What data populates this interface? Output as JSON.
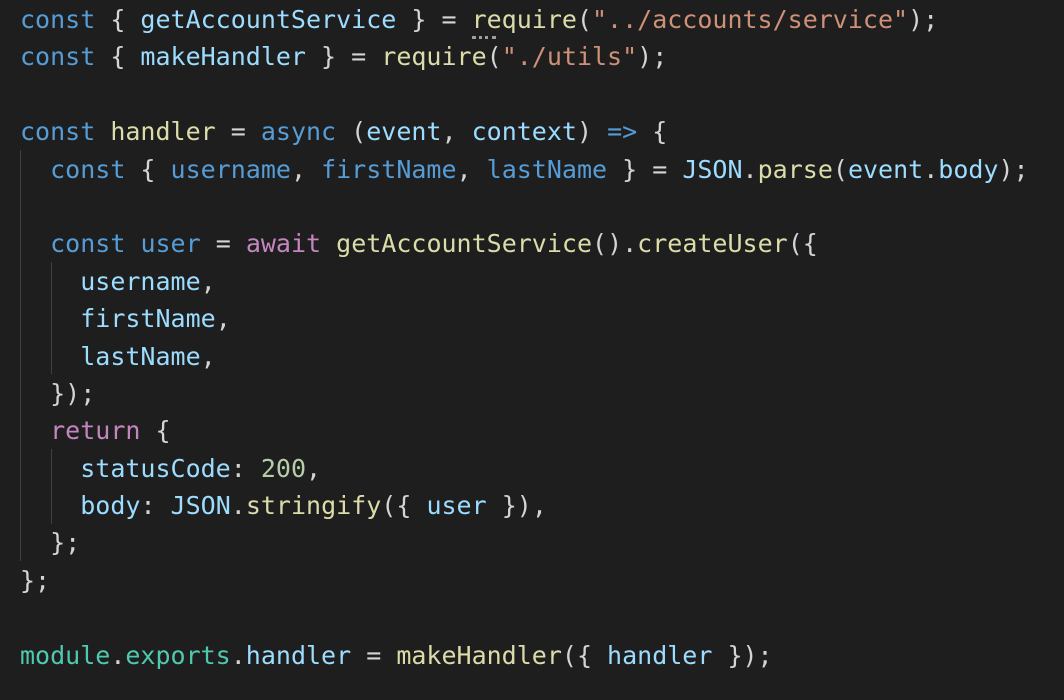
{
  "editor": {
    "background": "#1e1e1e",
    "lines": [
      [
        {
          "t": "const",
          "c": "kw"
        },
        {
          "t": " { ",
          "c": "pun"
        },
        {
          "t": "getAccountService",
          "c": "var"
        },
        {
          "t": " } = ",
          "c": "pun"
        },
        {
          "t": "require",
          "c": "fn"
        },
        {
          "t": "(",
          "c": "pun"
        },
        {
          "t": "\"../accounts/service\"",
          "c": "str"
        },
        {
          "t": ");",
          "c": "pun"
        }
      ],
      [
        {
          "t": "const",
          "c": "kw"
        },
        {
          "t": " { ",
          "c": "pun"
        },
        {
          "t": "makeHandler",
          "c": "var"
        },
        {
          "t": " } = ",
          "c": "pun"
        },
        {
          "t": "require",
          "c": "fn"
        },
        {
          "t": "(",
          "c": "pun"
        },
        {
          "t": "\"./utils\"",
          "c": "str"
        },
        {
          "t": ");",
          "c": "pun"
        }
      ],
      [],
      [
        {
          "t": "const",
          "c": "kw"
        },
        {
          "t": " ",
          "c": "pun"
        },
        {
          "t": "handler",
          "c": "fn"
        },
        {
          "t": " = ",
          "c": "pun"
        },
        {
          "t": "async",
          "c": "kw"
        },
        {
          "t": " (",
          "c": "pun"
        },
        {
          "t": "event",
          "c": "var"
        },
        {
          "t": ", ",
          "c": "pun"
        },
        {
          "t": "context",
          "c": "var"
        },
        {
          "t": ") ",
          "c": "pun"
        },
        {
          "t": "=>",
          "c": "kw"
        },
        {
          "t": " {",
          "c": "pun"
        }
      ],
      [
        {
          "t": "  ",
          "c": "pun"
        },
        {
          "t": "const",
          "c": "kw"
        },
        {
          "t": " { ",
          "c": "pun"
        },
        {
          "t": "username",
          "c": "kw"
        },
        {
          "t": ", ",
          "c": "pun"
        },
        {
          "t": "firstName",
          "c": "kw"
        },
        {
          "t": ", ",
          "c": "pun"
        },
        {
          "t": "lastName",
          "c": "kw"
        },
        {
          "t": " } = ",
          "c": "pun"
        },
        {
          "t": "JSON",
          "c": "var"
        },
        {
          "t": ".",
          "c": "pun"
        },
        {
          "t": "parse",
          "c": "fn"
        },
        {
          "t": "(",
          "c": "pun"
        },
        {
          "t": "event",
          "c": "var"
        },
        {
          "t": ".",
          "c": "pun"
        },
        {
          "t": "body",
          "c": "var"
        },
        {
          "t": ");",
          "c": "pun"
        }
      ],
      [],
      [
        {
          "t": "  ",
          "c": "pun"
        },
        {
          "t": "const",
          "c": "kw"
        },
        {
          "t": " ",
          "c": "pun"
        },
        {
          "t": "user",
          "c": "kw"
        },
        {
          "t": " = ",
          "c": "pun"
        },
        {
          "t": "await",
          "c": "kw2"
        },
        {
          "t": " ",
          "c": "pun"
        },
        {
          "t": "getAccountService",
          "c": "fn"
        },
        {
          "t": "().",
          "c": "pun"
        },
        {
          "t": "createUser",
          "c": "fn"
        },
        {
          "t": "({",
          "c": "pun"
        }
      ],
      [
        {
          "t": "    ",
          "c": "pun"
        },
        {
          "t": "username",
          "c": "var"
        },
        {
          "t": ",",
          "c": "pun"
        }
      ],
      [
        {
          "t": "    ",
          "c": "pun"
        },
        {
          "t": "firstName",
          "c": "var"
        },
        {
          "t": ",",
          "c": "pun"
        }
      ],
      [
        {
          "t": "    ",
          "c": "pun"
        },
        {
          "t": "lastName",
          "c": "var"
        },
        {
          "t": ",",
          "c": "pun"
        }
      ],
      [
        {
          "t": "  });",
          "c": "pun"
        }
      ],
      [
        {
          "t": "  ",
          "c": "pun"
        },
        {
          "t": "return",
          "c": "kw2"
        },
        {
          "t": " {",
          "c": "pun"
        }
      ],
      [
        {
          "t": "    ",
          "c": "pun"
        },
        {
          "t": "statusCode",
          "c": "var"
        },
        {
          "t": ": ",
          "c": "pun"
        },
        {
          "t": "200",
          "c": "num"
        },
        {
          "t": ",",
          "c": "pun"
        }
      ],
      [
        {
          "t": "    ",
          "c": "pun"
        },
        {
          "t": "body",
          "c": "var"
        },
        {
          "t": ": ",
          "c": "pun"
        },
        {
          "t": "JSON",
          "c": "var"
        },
        {
          "t": ".",
          "c": "pun"
        },
        {
          "t": "stringify",
          "c": "fn"
        },
        {
          "t": "({ ",
          "c": "pun"
        },
        {
          "t": "user",
          "c": "var"
        },
        {
          "t": " }),",
          "c": "pun"
        }
      ],
      [
        {
          "t": "  };",
          "c": "pun"
        }
      ],
      [
        {
          "t": "};",
          "c": "pun"
        }
      ],
      [],
      [
        {
          "t": "module",
          "c": "mod"
        },
        {
          "t": ".",
          "c": "pun"
        },
        {
          "t": "exports",
          "c": "mod"
        },
        {
          "t": ".",
          "c": "pun"
        },
        {
          "t": "handler",
          "c": "var"
        },
        {
          "t": " = ",
          "c": "pun"
        },
        {
          "t": "makeHandler",
          "c": "fn"
        },
        {
          "t": "({ ",
          "c": "pun"
        },
        {
          "t": "handler",
          "c": "var"
        },
        {
          "t": " });",
          "c": "pun"
        }
      ]
    ]
  }
}
